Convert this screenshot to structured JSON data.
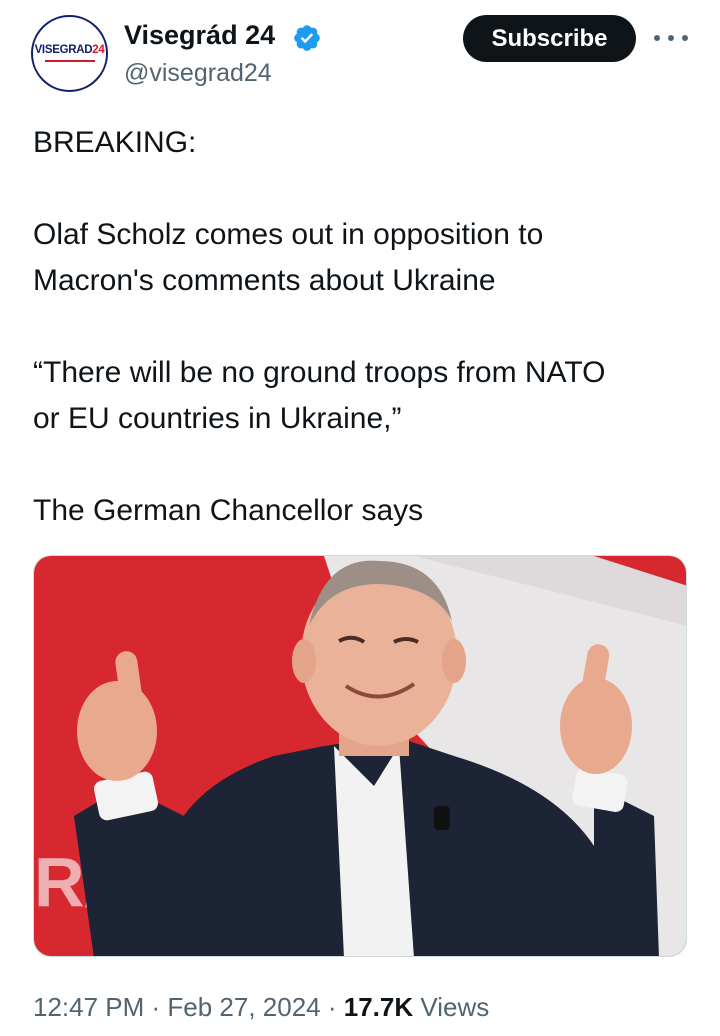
{
  "author": {
    "avatar_text_main": "VISEGRAD",
    "avatar_text_num": "24",
    "display_name": "Visegrád 24",
    "handle": "@visegrad24",
    "verified_icon": "verified-badge-icon"
  },
  "actions": {
    "subscribe_label": "Subscribe",
    "more_icon": "more-options-icon"
  },
  "tweet": {
    "lines": [
      "BREAKING:",
      "Olaf Scholz comes out in opposition to",
      "Macron's comments about Ukraine",
      "“There will be no ground troops from NATO",
      "or EU countries in Ukraine,”",
      "The German Chancellor says"
    ],
    "media_alt": "photo"
  },
  "meta": {
    "time": "12:47 PM",
    "sep1": " · ",
    "date": "Feb 27, 2024",
    "sep2": " · ",
    "views_count": "17.7K",
    "views_label": " Views"
  },
  "colors": {
    "accent_blue": "#1d9bf0",
    "text_primary": "#0f1419",
    "text_secondary": "#536471",
    "photo_red": "#d7282f"
  }
}
